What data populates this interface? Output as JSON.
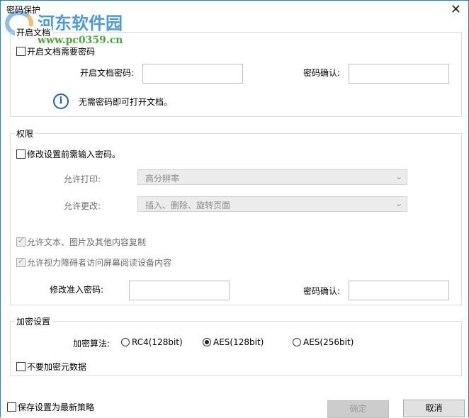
{
  "window": {
    "title": "密码保护",
    "close": "✕"
  },
  "watermark": {
    "name": "河东软件园",
    "url": "www.pc0359.cn"
  },
  "open_doc": {
    "legend": "开启文档",
    "require_label": "开启文档需要密码",
    "password_label": "开启文档密码:",
    "confirm_label": "密码确认:",
    "info_icon": "i",
    "info_text": "无需密码即可打开文档。"
  },
  "permissions": {
    "legend": "权限",
    "require_label": "修改设置前需输入密码。",
    "print_label": "允许打印:",
    "print_value": "高分辨率",
    "change_label": "允许更改:",
    "change_value": "插入、删除、旋转页面",
    "copy_label": "允许文本、图片及其他内容复制",
    "access_label": "允许视力障碍者访问屏幕阅读设备内容",
    "password_label": "修改准入密码:",
    "confirm_label": "密码确认:"
  },
  "encryption": {
    "legend": "加密设置",
    "algo_label": "加密算法:",
    "options": [
      "RC4(128bit)",
      "AES(128bit)",
      "AES(256bit)"
    ],
    "selected": "AES(128bit)",
    "no_meta_label": "不要加密元数据"
  },
  "footer": {
    "save_label": "保存设置为最新策略",
    "ok": "确定",
    "cancel": "取消"
  }
}
